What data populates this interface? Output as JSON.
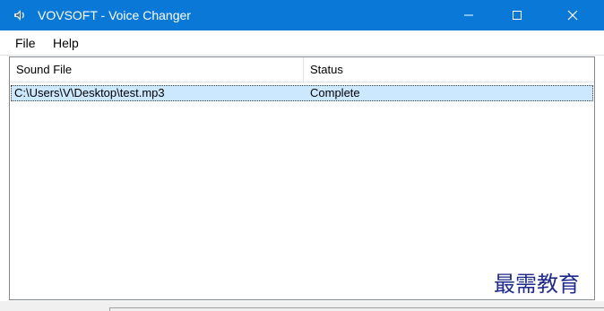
{
  "window": {
    "title": "VOVSOFT - Voice Changer",
    "accent_color": "#0a78d7",
    "app_icon": "speaker-icon",
    "controls": [
      "minimize-icon",
      "maximize-icon",
      "close-icon"
    ]
  },
  "menu": {
    "file": "File",
    "help": "Help"
  },
  "table": {
    "columns": [
      "Sound File",
      "Status"
    ],
    "rows": [
      {
        "file": "C:\\Users\\V\\Desktop\\test.mp3",
        "status": "Complete"
      }
    ],
    "selected_row_color": "#cce8ff"
  },
  "watermark": "最需教育"
}
